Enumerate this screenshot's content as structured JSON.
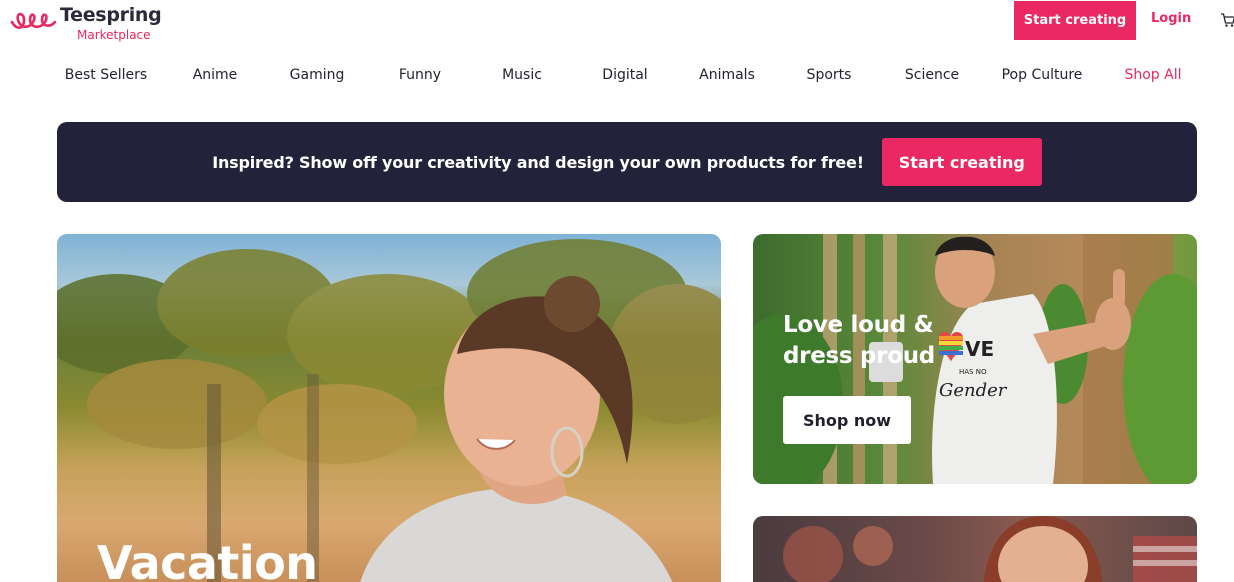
{
  "header": {
    "brand_name": "Teespring",
    "brand_sub": "Marketplace",
    "start_label": "Start creating",
    "login_label": "Login"
  },
  "nav": {
    "items": [
      "Best Sellers",
      "Anime",
      "Gaming",
      "Funny",
      "Music",
      "Digital",
      "Animals",
      "Sports",
      "Science",
      "Pop Culture",
      "Shop All"
    ]
  },
  "promo": {
    "text": "Inspired? Show off your creativity and design your own products for free!",
    "button_label": "Start creating"
  },
  "hero_main": {
    "title": "Vacation"
  },
  "hero_pride": {
    "title": "Love loud & dress proud",
    "button_label": "Shop now",
    "shirt_text_top": "LOVE",
    "shirt_text_mid": "HAS NO",
    "shirt_text_bottom": "Gender"
  },
  "colors": {
    "accent": "#ea2861",
    "dark": "#22223a",
    "text": "#23232f"
  },
  "icons": {
    "logo": "teespring-loops-icon",
    "cart": "cart-icon"
  }
}
